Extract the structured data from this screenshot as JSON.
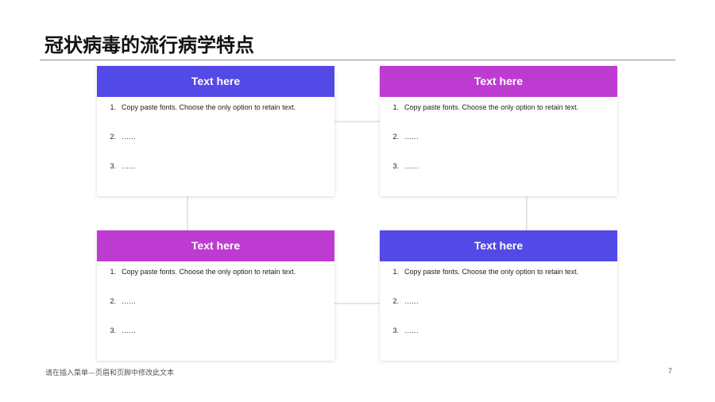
{
  "slide": {
    "title": "冠状病毒的流行病学特点",
    "footer_note": "请在插入菜单—页眉和页脚中修改此文本",
    "page_number": "7"
  },
  "colors": {
    "blue": "#5249e6",
    "purple": "#be3bd1",
    "connector": "#e6e6e6"
  },
  "cards": [
    {
      "header": "Text here",
      "color": "#5249e6",
      "items": [
        {
          "num": "1.",
          "text": "Copy paste fonts. Choose the only option to retain text."
        },
        {
          "num": "2.",
          "text": "……"
        },
        {
          "num": "3.",
          "text": "……"
        }
      ]
    },
    {
      "header": "Text here",
      "color": "#be3bd1",
      "items": [
        {
          "num": "1.",
          "text": "Copy paste fonts. Choose the only option to retain text."
        },
        {
          "num": "2.",
          "text": "……"
        },
        {
          "num": "3.",
          "text": "……"
        }
      ]
    },
    {
      "header": "Text here",
      "color": "#be3bd1",
      "items": [
        {
          "num": "1.",
          "text": "Copy paste fonts. Choose the only option to retain text."
        },
        {
          "num": "2.",
          "text": "……"
        },
        {
          "num": "3.",
          "text": "……"
        }
      ]
    },
    {
      "header": "Text here",
      "color": "#5249e6",
      "items": [
        {
          "num": "1.",
          "text": "Copy paste fonts. Choose the only option to retain text."
        },
        {
          "num": "2.",
          "text": "……"
        },
        {
          "num": "3.",
          "text": "……"
        }
      ]
    }
  ]
}
